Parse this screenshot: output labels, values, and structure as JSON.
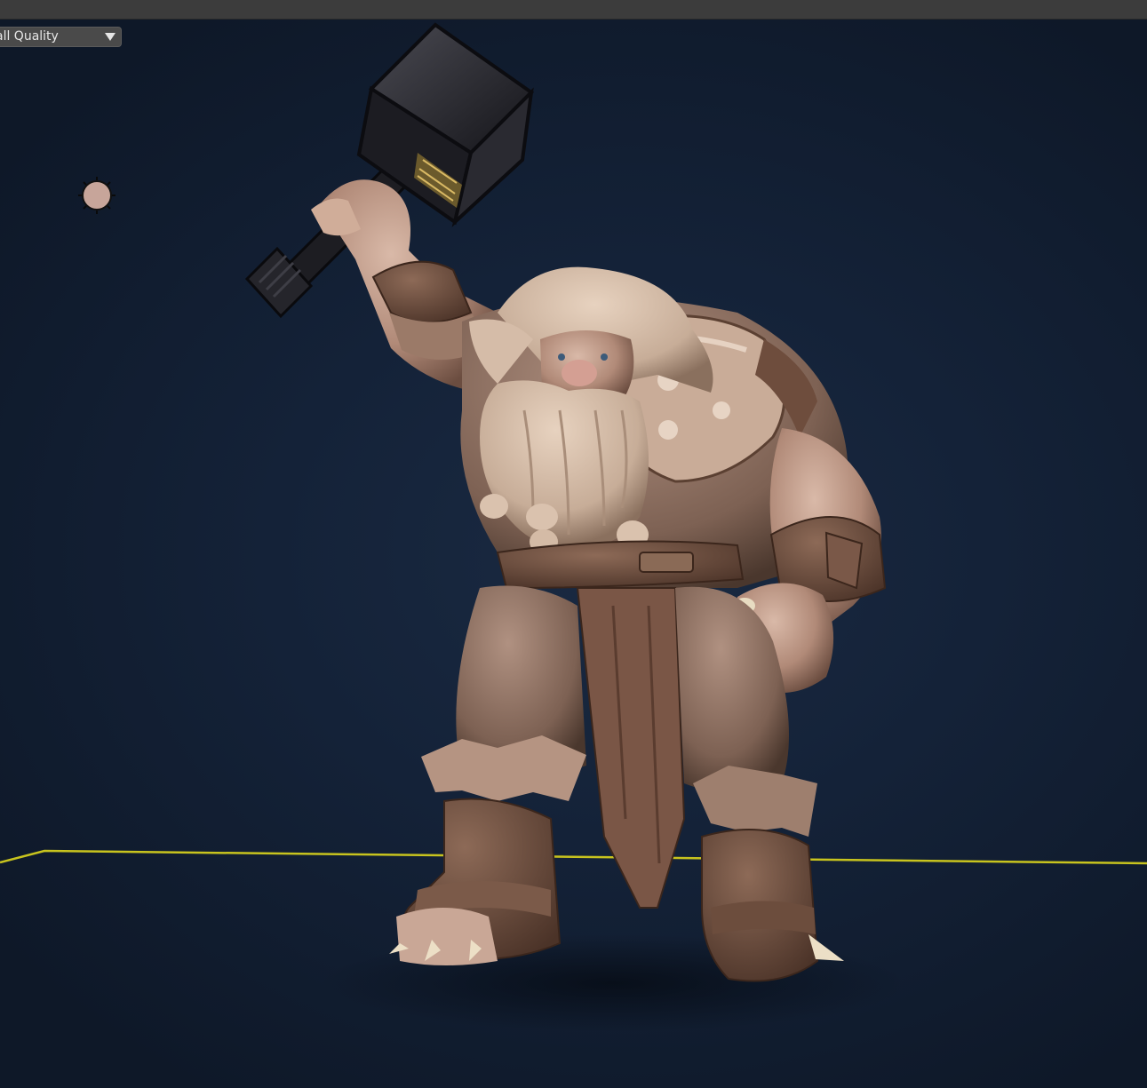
{
  "viewport": {
    "quality_dropdown": {
      "label": "all Quality",
      "icon": "triangle-down-icon"
    },
    "light_gizmo": {
      "icon": "sun-light-icon",
      "color": "#c7a59a"
    },
    "ground_line": {
      "color": "#c8c41e"
    },
    "background_color": "#142238"
  }
}
